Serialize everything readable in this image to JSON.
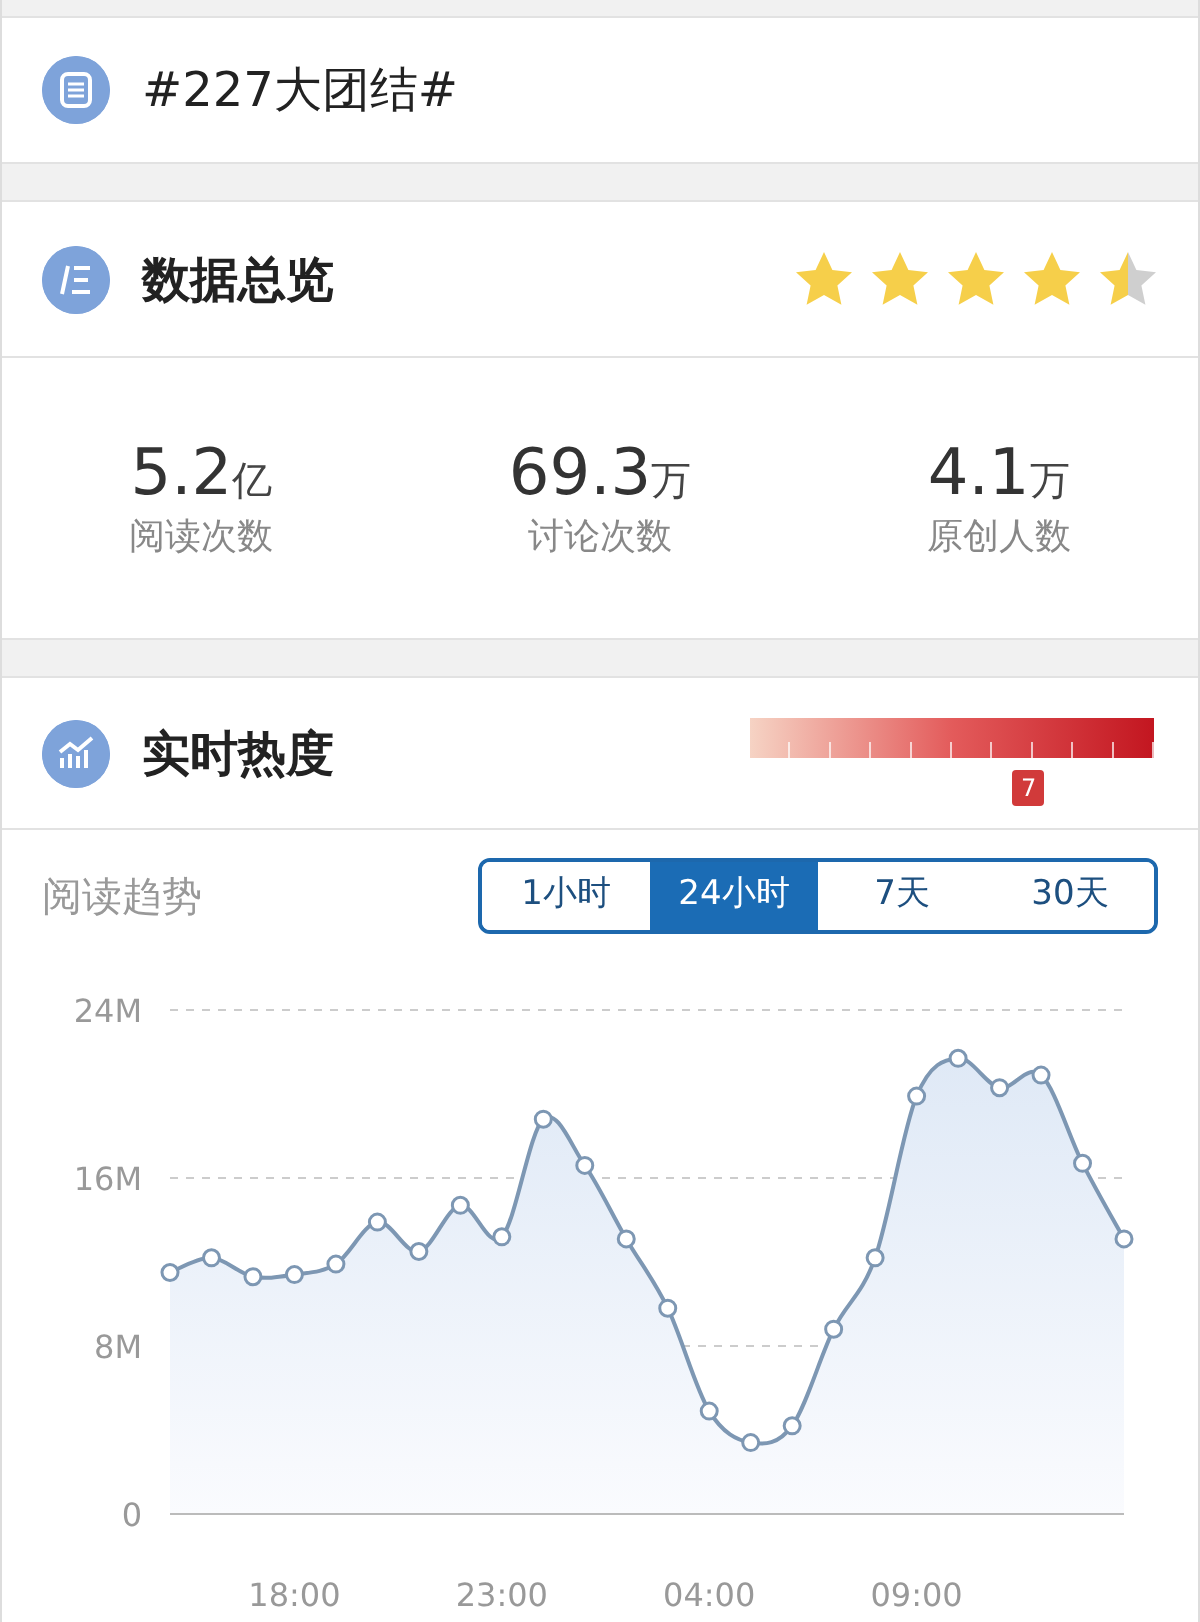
{
  "topic": {
    "title": "#227大团结#"
  },
  "overview": {
    "title": "数据总览",
    "stars": 4.5,
    "stats": [
      {
        "value": "5.2",
        "unit": "亿",
        "label": "阅读次数"
      },
      {
        "value": "69.3",
        "unit": "万",
        "label": "讨论次数"
      },
      {
        "value": "4.1",
        "unit": "万",
        "label": "原创人数"
      }
    ]
  },
  "heat": {
    "title": "实时热度",
    "level": 0.69,
    "marker": "7"
  },
  "trend": {
    "title": "阅读趋势",
    "tabs": [
      {
        "label": "1小时",
        "selected": false
      },
      {
        "label": "24小时",
        "selected": true
      },
      {
        "label": "7天",
        "selected": false
      },
      {
        "label": "30天",
        "selected": false
      }
    ],
    "chart_data": {
      "type": "area",
      "categories": [
        null,
        null,
        null,
        "18:00",
        null,
        null,
        null,
        null,
        "23:00",
        null,
        null,
        null,
        null,
        "04:00",
        null,
        null,
        null,
        null,
        "09:00",
        null,
        null,
        null,
        null,
        null
      ],
      "ylim": [
        0,
        24
      ],
      "yticks": [
        {
          "value": 0,
          "label": "0"
        },
        {
          "value": 8,
          "label": "8M"
        },
        {
          "value": 16,
          "label": "16M"
        },
        {
          "value": 24,
          "label": "24M"
        }
      ],
      "series": [
        {
          "color": "#7d97b3",
          "marker": "o",
          "values": [
            11.5,
            12.2,
            11.3,
            11.4,
            11.9,
            13.9,
            12.5,
            14.7,
            13.2,
            18.8,
            16.6,
            13.1,
            9.8,
            4.9,
            3.4,
            4.2,
            8.8,
            12.2,
            19.9,
            21.7,
            20.3,
            20.9,
            16.7,
            13.1
          ]
        }
      ]
    }
  }
}
